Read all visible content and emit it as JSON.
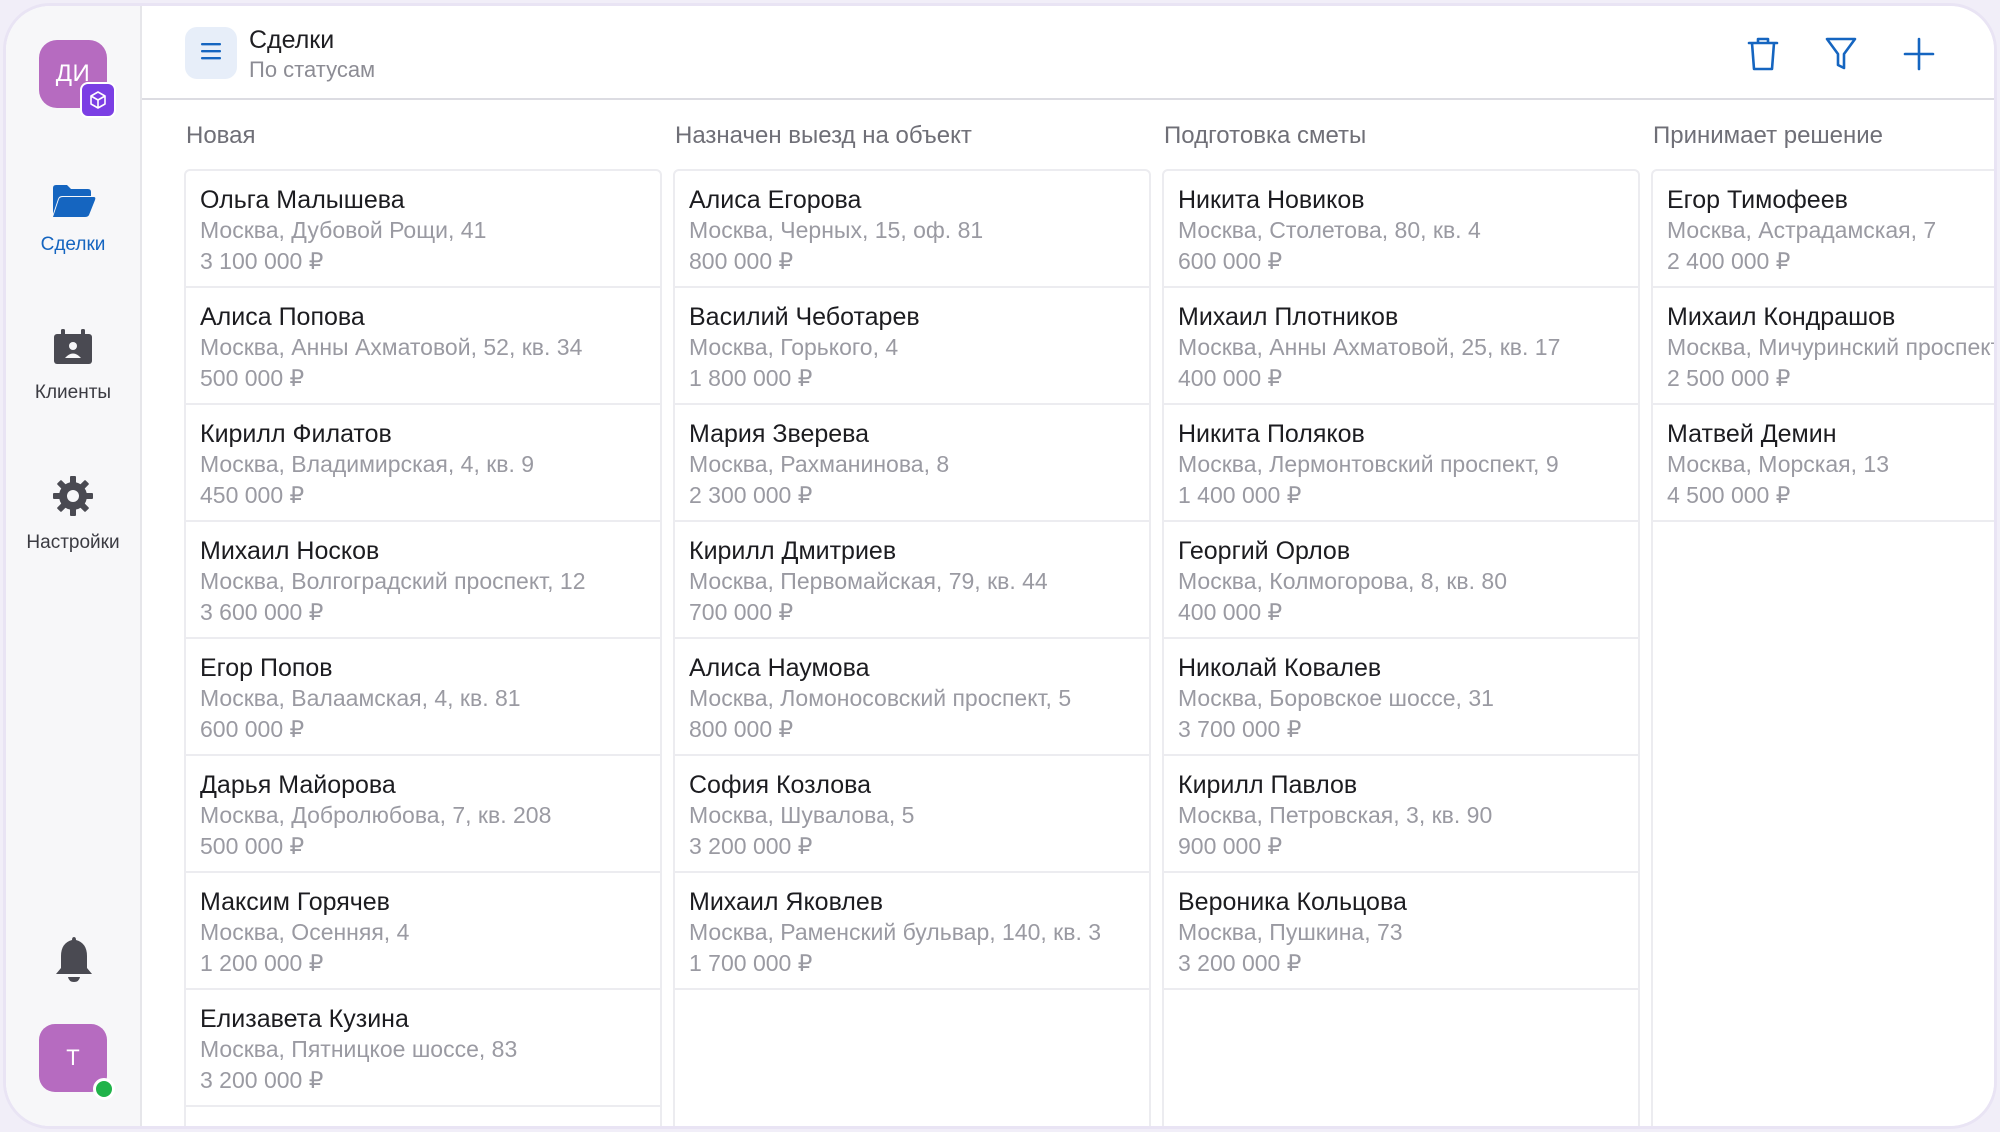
{
  "org": {
    "initials": "ДИ"
  },
  "user": {
    "initial": "Т"
  },
  "sidebar": {
    "items": [
      {
        "label": "Сделки",
        "icon": "folder-icon"
      },
      {
        "label": "Клиенты",
        "icon": "calendar-contact-icon"
      },
      {
        "label": "Настройки",
        "icon": "gear-icon"
      }
    ]
  },
  "header": {
    "title": "Сделки",
    "subtitle": "По статусам"
  },
  "colors": {
    "accent": "#1565c0",
    "avatar": "#b66bc0",
    "badge": "#7b3fe4"
  },
  "columns": [
    {
      "title": "Новая",
      "cards": [
        {
          "name": "Ольга Малышева",
          "address": "Москва, Дубовой Рощи, 41",
          "amount": "3 100 000 ₽"
        },
        {
          "name": "Алиса Попова",
          "address": "Москва, Анны Ахматовой, 52, кв. 34",
          "amount": "500 000 ₽"
        },
        {
          "name": "Кирилл Филатов",
          "address": "Москва, Владимирская, 4, кв. 9",
          "amount": "450 000 ₽"
        },
        {
          "name": "Михаил Носков",
          "address": "Москва, Волгоградский проспект, 12",
          "amount": "3 600 000 ₽"
        },
        {
          "name": "Егор Попов",
          "address": "Москва, Валаамская, 4, кв. 81",
          "amount": "600 000 ₽"
        },
        {
          "name": "Дарья Майорова",
          "address": "Москва, Добролюбова, 7, кв. 208",
          "amount": "500 000 ₽"
        },
        {
          "name": "Максим Горячев",
          "address": "Москва, Осенняя, 4",
          "amount": "1 200 000 ₽"
        },
        {
          "name": "Елизавета Кузина",
          "address": "Москва, Пятницкое шоссе, 83",
          "amount": "3 200 000 ₽"
        }
      ]
    },
    {
      "title": "Назначен выезд на объект",
      "cards": [
        {
          "name": "Алиса Егорова",
          "address": "Москва, Черных, 15, оф. 81",
          "amount": "800 000 ₽"
        },
        {
          "name": "Василий Чеботарев",
          "address": "Москва, Горького, 4",
          "amount": "1 800 000 ₽"
        },
        {
          "name": "Мария Зверева",
          "address": "Москва, Рахманинова, 8",
          "amount": "2 300 000 ₽"
        },
        {
          "name": "Кирилл Дмитриев",
          "address": "Москва, Первомайская, 79, кв. 44",
          "amount": "700 000 ₽"
        },
        {
          "name": "Алиса Наумова",
          "address": "Москва, Ломоносовский проспект, 5",
          "amount": "800 000 ₽"
        },
        {
          "name": "София Козлова",
          "address": "Москва, Шувалова, 5",
          "amount": "3 200 000 ₽"
        },
        {
          "name": "Михаил Яковлев",
          "address": "Москва, Раменский бульвар, 140, кв. 3",
          "amount": "1 700 000 ₽"
        }
      ]
    },
    {
      "title": "Подготовка сметы",
      "cards": [
        {
          "name": "Никита Новиков",
          "address": "Москва, Столетова, 80, кв. 4",
          "amount": "600 000 ₽"
        },
        {
          "name": "Михаил Плотников",
          "address": "Москва, Анны Ахматовой, 25, кв. 17",
          "amount": "400 000 ₽"
        },
        {
          "name": "Никита Поляков",
          "address": "Москва, Лермонтовский проспект, 9",
          "amount": "1 400 000 ₽"
        },
        {
          "name": "Георгий Орлов",
          "address": "Москва, Колмогорова, 8, кв. 80",
          "amount": "400 000 ₽"
        },
        {
          "name": "Николай Ковалев",
          "address": "Москва, Боровское шоссе, 31",
          "amount": "3 700 000 ₽"
        },
        {
          "name": "Кирилл Павлов",
          "address": "Москва, Петровская, 3, кв. 90",
          "amount": "900 000 ₽"
        },
        {
          "name": "Вероника Кольцова",
          "address": "Москва, Пушкина, 73",
          "amount": "3 200 000 ₽"
        }
      ]
    },
    {
      "title": "Принимает решение",
      "cards": [
        {
          "name": "Егор Тимофеев",
          "address": "Москва, Астрадамская, 7",
          "amount": "2 400 000 ₽"
        },
        {
          "name": "Михаил Кондрашов",
          "address": "Москва, Мичуринский проспект",
          "amount": "2 500 000 ₽"
        },
        {
          "name": "Матвей Демин",
          "address": "Москва, Морская, 13",
          "amount": "4 500 000 ₽"
        }
      ]
    }
  ]
}
